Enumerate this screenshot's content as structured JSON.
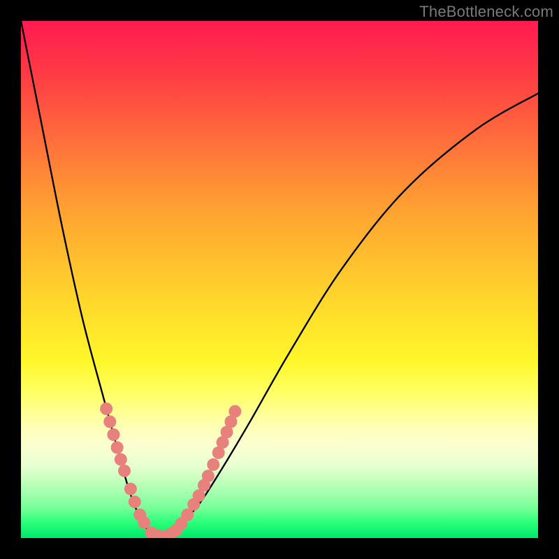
{
  "watermark": "TheBottleneck.com",
  "colors": {
    "frame": "#000000",
    "curve": "#000000",
    "dot": "#e8807c",
    "gradient_top": "#ff1a51",
    "gradient_bottom": "#00e96b"
  },
  "chart_data": {
    "type": "line",
    "title": "",
    "xlabel": "",
    "ylabel": "",
    "xlim": [
      0,
      100
    ],
    "ylim": [
      0,
      100
    ],
    "grid": false,
    "legend": false,
    "series": [
      {
        "name": "bottleneck-curve",
        "x": [
          0,
          4,
          8,
          12,
          16,
          19,
          21,
          23,
          25,
          27,
          30,
          34,
          38,
          44,
          52,
          62,
          74,
          88,
          100
        ],
        "y": [
          100,
          80,
          60,
          42,
          27,
          16,
          9,
          4,
          1,
          0,
          2,
          6,
          12,
          22,
          36,
          52,
          67,
          79,
          86
        ]
      }
    ],
    "marker_clusters": [
      {
        "name": "left-upper",
        "points": [
          {
            "x": 16.5,
            "y": 25
          },
          {
            "x": 17.2,
            "y": 22.5
          },
          {
            "x": 17.9,
            "y": 20
          },
          {
            "x": 18.6,
            "y": 17.5
          },
          {
            "x": 19.3,
            "y": 15.2
          },
          {
            "x": 20.0,
            "y": 13
          }
        ]
      },
      {
        "name": "left-mid",
        "points": [
          {
            "x": 21.2,
            "y": 9.5
          },
          {
            "x": 22.0,
            "y": 7.0
          }
        ]
      },
      {
        "name": "left-low",
        "points": [
          {
            "x": 23.0,
            "y": 4.5
          },
          {
            "x": 23.8,
            "y": 3.0
          }
        ]
      },
      {
        "name": "bottom",
        "points": [
          {
            "x": 25.2,
            "y": 1.0
          },
          {
            "x": 26.4,
            "y": 0.5
          },
          {
            "x": 27.6,
            "y": 0.3
          },
          {
            "x": 28.8,
            "y": 0.7
          },
          {
            "x": 30.0,
            "y": 1.5
          }
        ]
      },
      {
        "name": "right-low",
        "points": [
          {
            "x": 31.0,
            "y": 2.8
          },
          {
            "x": 32.2,
            "y": 4.5
          },
          {
            "x": 33.4,
            "y": 6.5
          },
          {
            "x": 34.4,
            "y": 8.2
          }
        ]
      },
      {
        "name": "right-mid",
        "points": [
          {
            "x": 35.4,
            "y": 10.2
          },
          {
            "x": 36.2,
            "y": 12.0
          }
        ]
      },
      {
        "name": "right-upper",
        "points": [
          {
            "x": 37.2,
            "y": 14.2
          },
          {
            "x": 38.2,
            "y": 16.5
          },
          {
            "x": 39.0,
            "y": 18.5
          },
          {
            "x": 39.8,
            "y": 20.5
          },
          {
            "x": 40.6,
            "y": 22.5
          },
          {
            "x": 41.4,
            "y": 24.5
          }
        ]
      }
    ]
  }
}
